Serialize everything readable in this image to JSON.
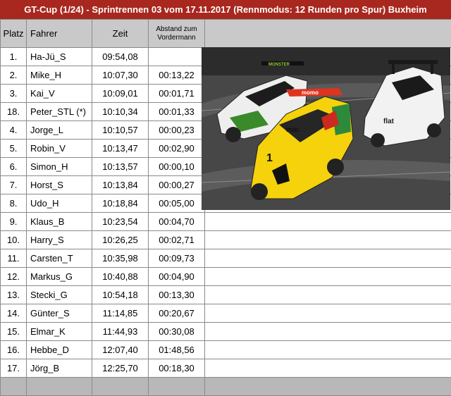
{
  "title": "GT-Cup (1/24)  -  Sprintrennen 03 vom 17.11.2017 (Rennmodus: 12 Runden pro Spur) Buxheim",
  "columns": {
    "platz": "Platz",
    "fahrer": "Fahrer",
    "zeit": "Zeit",
    "abstand_line1": "Abstand zum",
    "abstand_line2": "Vordermann"
  },
  "rows": [
    {
      "platz": "1.",
      "fahrer": "Ha-Jü_S",
      "zeit": "09:54,08",
      "abstand": ""
    },
    {
      "platz": "2.",
      "fahrer": "Mike_H",
      "zeit": "10:07,30",
      "abstand": "00:13,22"
    },
    {
      "platz": "3.",
      "fahrer": "Kai_V",
      "zeit": "10:09,01",
      "abstand": "00:01,71"
    },
    {
      "platz": "18.",
      "fahrer": "Peter_STL (*)",
      "zeit": "10:10,34",
      "abstand": "00:01,33"
    },
    {
      "platz": "4.",
      "fahrer": "Jorge_L",
      "zeit": "10:10,57",
      "abstand": "00:00,23"
    },
    {
      "platz": "5.",
      "fahrer": "Robin_V",
      "zeit": "10:13,47",
      "abstand": "00:02,90"
    },
    {
      "platz": "6.",
      "fahrer": "Simon_H",
      "zeit": "10:13,57",
      "abstand": "00:00,10"
    },
    {
      "platz": "7.",
      "fahrer": "Horst_S",
      "zeit": "10:13,84",
      "abstand": "00:00,27"
    },
    {
      "platz": "8.",
      "fahrer": "Udo_H",
      "zeit": "10:18,84",
      "abstand": "00:05,00"
    },
    {
      "platz": "9.",
      "fahrer": "Klaus_B",
      "zeit": "10:23,54",
      "abstand": "00:04,70"
    },
    {
      "platz": "10.",
      "fahrer": "Harry_S",
      "zeit": "10:26,25",
      "abstand": "00:02,71"
    },
    {
      "platz": "11.",
      "fahrer": "Carsten_T",
      "zeit": "10:35,98",
      "abstand": "00:09,73"
    },
    {
      "platz": "12.",
      "fahrer": "Markus_G",
      "zeit": "10:40,88",
      "abstand": "00:04,90"
    },
    {
      "platz": "13.",
      "fahrer": "Stecki_G",
      "zeit": "10:54,18",
      "abstand": "00:13,30"
    },
    {
      "platz": "14.",
      "fahrer": "Günter_S",
      "zeit": "11:14,85",
      "abstand": "00:20,67"
    },
    {
      "platz": "15.",
      "fahrer": "Elmar_K",
      "zeit": "11:44,93",
      "abstand": "00:30,08"
    },
    {
      "platz": "16.",
      "fahrer": "Hebbe_D",
      "zeit": "12:07,40",
      "abstand": "01:48,56"
    },
    {
      "platz": "17.",
      "fahrer": "Jörg_B",
      "zeit": "12:25,70",
      "abstand": "00:18,30"
    }
  ],
  "photo": {
    "car_left_text": "MONSTER",
    "car_middle_text": "momo",
    "car_middle_number": "1",
    "car_middle_sponsor": "mar.",
    "car_right_text": "flat"
  },
  "colors": {
    "title_bg": "#a8271e",
    "header_bg": "#c9c9c9",
    "footer_bg": "#b8b8b8"
  }
}
